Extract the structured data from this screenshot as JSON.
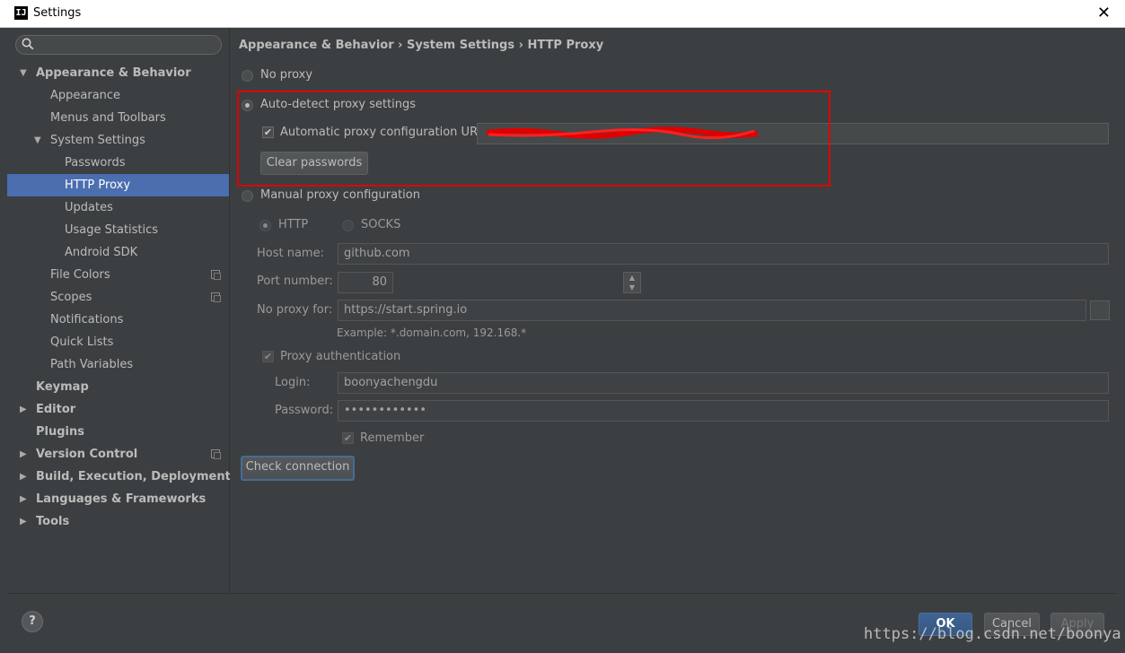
{
  "window": {
    "title": "Settings",
    "app_icon": "IJ",
    "close_glyph": "✕"
  },
  "sidebar": {
    "search_placeholder": "",
    "items": [
      {
        "label": "Appearance & Behavior",
        "arrow": "▼"
      },
      {
        "label": "Appearance"
      },
      {
        "label": "Menus and Toolbars"
      },
      {
        "label": "System Settings",
        "arrow": "▼"
      },
      {
        "label": "Passwords"
      },
      {
        "label": "HTTP Proxy"
      },
      {
        "label": "Updates"
      },
      {
        "label": "Usage Statistics"
      },
      {
        "label": "Android SDK"
      },
      {
        "label": "File Colors"
      },
      {
        "label": "Scopes"
      },
      {
        "label": "Notifications"
      },
      {
        "label": "Quick Lists"
      },
      {
        "label": "Path Variables"
      },
      {
        "label": "Keymap"
      },
      {
        "label": "Editor",
        "arrow": "▶"
      },
      {
        "label": "Plugins"
      },
      {
        "label": "Version Control",
        "arrow": "▶"
      },
      {
        "label": "Build, Execution, Deployment",
        "arrow": "▶"
      },
      {
        "label": "Languages & Frameworks",
        "arrow": "▶"
      },
      {
        "label": "Tools",
        "arrow": "▶"
      }
    ]
  },
  "main": {
    "breadcrumb": "Appearance & Behavior › System Settings › HTTP Proxy",
    "no_proxy_label": "No proxy",
    "auto_detect_label": "Auto-detect proxy settings",
    "auto_config_label": "Automatic proxy configuration URL:",
    "auto_config_checked": "✔",
    "auto_config_url": "",
    "clear_passwords_label": "Clear passwords",
    "manual_label": "Manual proxy configuration",
    "http_label": "HTTP",
    "socks_label": "SOCKS",
    "host_label": "Host name:",
    "host_value": "github.com",
    "port_label": "Port number:",
    "port_value": "80",
    "no_proxy_for_label": "No proxy for:",
    "no_proxy_for_value": "https://start.spring.io",
    "example_text": "Example: *.domain.com, 192.168.*",
    "proxy_auth_label": "Proxy authentication",
    "login_label": "Login:",
    "login_value": "boonyachengdu",
    "password_label": "Password:",
    "password_value": "••••••••••••",
    "remember_label": "Remember",
    "check_connection_label": "Check connection"
  },
  "footer": {
    "help_glyph": "?",
    "ok_label": "OK",
    "cancel_label": "Cancel",
    "apply_label": "Apply",
    "watermark": "https://blog.csdn.net/boonya"
  },
  "colors": {
    "background": "#3c3f41",
    "selection": "#4b6eaf",
    "highlight_box": "#e00000",
    "primary_button": "#365880"
  }
}
